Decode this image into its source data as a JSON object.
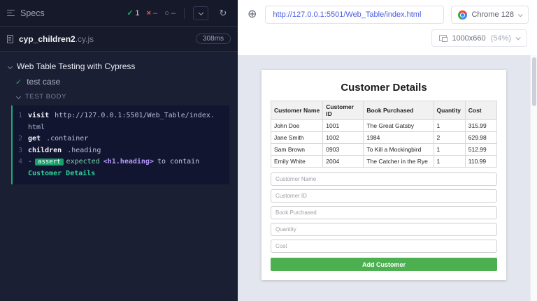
{
  "left_panel": {
    "title": "Specs",
    "stats": {
      "passed_icon": "✓",
      "passed": "1",
      "failed_icon": "×",
      "failed": "–",
      "pending_icon": "○",
      "pending": "–"
    },
    "reload_icon": "↻",
    "spec": {
      "name": "cyp_children2",
      "ext": ".cy.js",
      "duration": "308ms"
    },
    "suite_title": "Web Table Testing with Cypress",
    "test_check_icon": "✓",
    "test_name": "test case",
    "body_label": "TEST BODY",
    "commands": [
      {
        "num": "1",
        "method": "visit",
        "args": "http://127.0.0.1:5501/Web_Table/index.html"
      },
      {
        "num": "2",
        "method": "get",
        "args": ".container"
      },
      {
        "num": "3",
        "method": "children",
        "args": ".heading"
      },
      {
        "num": "4",
        "prefix": "-",
        "badge": "assert",
        "expected": "expected",
        "subject": "<h1.heading>",
        "verb": "to contain",
        "value": "Customer Details"
      }
    ]
  },
  "browser_bar": {
    "selector_icon": "⊕",
    "url": "http://127.0.0.1:5501/Web_Table/index.html",
    "browser": "Chrome 128",
    "viewport": "1000x660",
    "zoom": "(54%)"
  },
  "app": {
    "title": "Customer Details",
    "accent_color": "#4caf50",
    "table": {
      "headers": [
        "Customer Name",
        "Customer ID",
        "Book Purchased",
        "Quantity",
        "Cost"
      ],
      "rows": [
        [
          "John Doe",
          "1001",
          "The Great Gatsby",
          "1",
          "315.99"
        ],
        [
          "Jane Smith",
          "1002",
          "1984",
          "2",
          "629.98"
        ],
        [
          "Sam Brown",
          "0903",
          "To Kill a Mockingbird",
          "1",
          "512.99"
        ],
        [
          "Emily White",
          "2004",
          "The Catcher in the Rye",
          "1",
          "110.99"
        ]
      ]
    },
    "form": {
      "placeholders": [
        "Customer Name",
        "Customer ID",
        "Book Purchased",
        "Quantity",
        "Cost"
      ],
      "submit_label": "Add Customer"
    }
  }
}
